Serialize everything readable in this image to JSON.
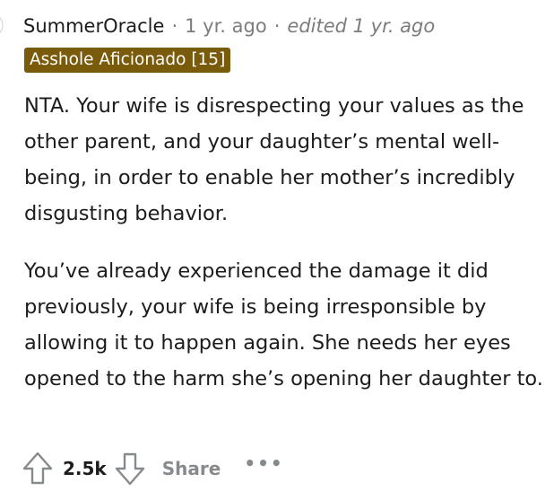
{
  "comment": {
    "author": "SummerOracle",
    "separator": "·",
    "time": "1 yr. ago",
    "edited": "edited 1 yr. ago",
    "flair": "Asshole Aficionado [15]",
    "paragraphs": [
      "NTA. Your wife is disrespecting your values as the other parent, and your daughter’s mental well-being, in order to enable her mother’s incredibly disgusting behavior.",
      "You’ve already experienced the damage it did previously, your wife is being irresponsible by allowing it to happen again. She needs her eyes opened to the harm she’s opening her daughter to."
    ]
  },
  "actions": {
    "score": "2.5k",
    "share_label": "Share",
    "more_label": "•••"
  },
  "colors": {
    "flair_bg": "#7a5b0c",
    "muted_text": "#7c7c7c",
    "action_gray": "#878a8c"
  }
}
